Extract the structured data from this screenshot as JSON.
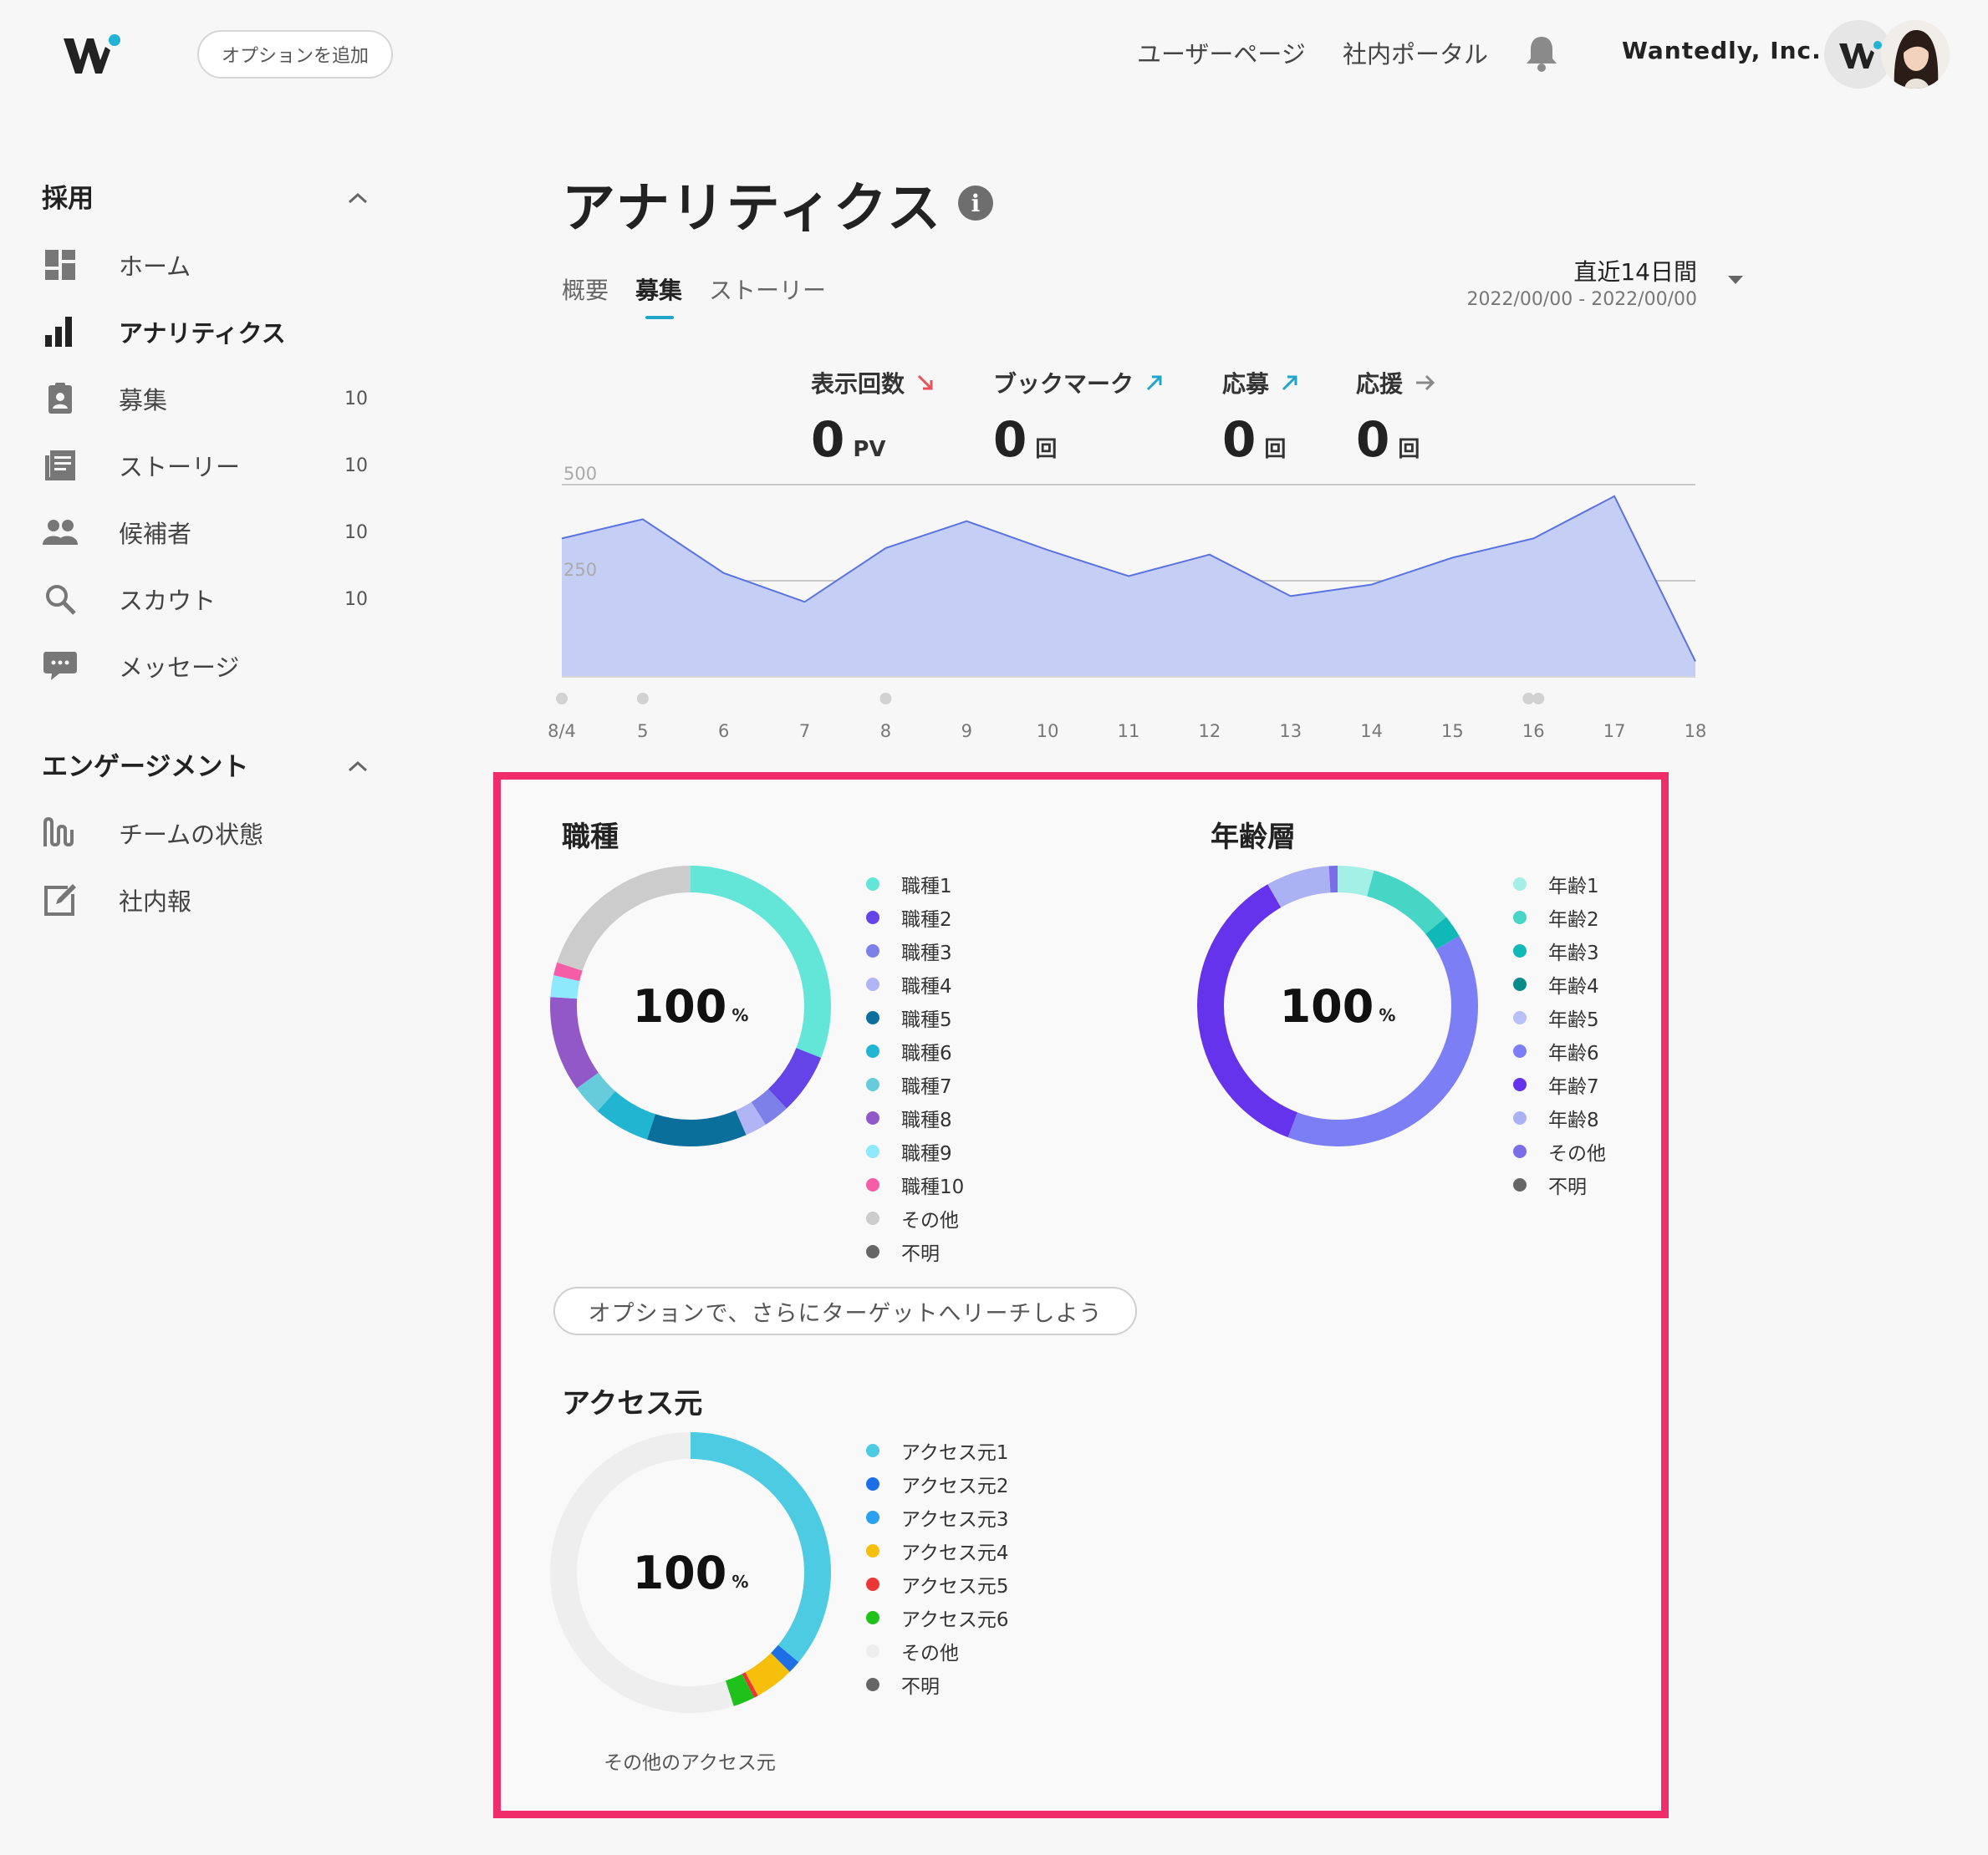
{
  "header": {
    "add_option_label": "オプションを追加",
    "nav": [
      "ユーザーページ",
      "社内ポータル"
    ],
    "company": "Wantedly, Inc."
  },
  "sidebar": {
    "sections": [
      {
        "title": "採用",
        "items": [
          {
            "label": "ホーム",
            "icon": "dashboard-icon",
            "count": ""
          },
          {
            "label": "アナリティクス",
            "icon": "bar-chart-icon",
            "count": "",
            "active": true
          },
          {
            "label": "募集",
            "icon": "recruit-icon",
            "count": "10"
          },
          {
            "label": "ストーリー",
            "icon": "story-icon",
            "count": "10"
          },
          {
            "label": "候補者",
            "icon": "people-icon",
            "count": "10"
          },
          {
            "label": "スカウト",
            "icon": "search-icon",
            "count": "10"
          },
          {
            "label": "メッセージ",
            "icon": "message-icon",
            "count": ""
          }
        ]
      },
      {
        "title": "エンゲージメント",
        "items": [
          {
            "label": "チームの状態",
            "icon": "team-status-icon",
            "count": ""
          },
          {
            "label": "社内報",
            "icon": "newsletter-icon",
            "count": ""
          }
        ]
      }
    ]
  },
  "main": {
    "title": "アナリティクス",
    "tabs": [
      "概要",
      "募集",
      "ストーリー"
    ],
    "active_tab": "募集",
    "period": {
      "label": "直近14日間",
      "range": "2022/00/00 - 2022/00/00"
    },
    "stats": [
      {
        "label": "表示回数",
        "value": "0",
        "unit": "PV",
        "trend": "down",
        "trend_color": "#e8505b"
      },
      {
        "label": "ブックマーク",
        "value": "0",
        "unit": "回",
        "trend": "up",
        "trend_color": "#21a6c8"
      },
      {
        "label": "応募",
        "value": "0",
        "unit": "回",
        "trend": "up",
        "trend_color": "#21a6c8"
      },
      {
        "label": "応援",
        "value": "0",
        "unit": "回",
        "trend": "flat",
        "trend_color": "#888888"
      }
    ],
    "cta_label": "オプションで、さらにターゲットへリーチしよう"
  },
  "chart_data": [
    {
      "type": "area",
      "x": [
        "8/4",
        "5",
        "6",
        "7",
        "8",
        "9",
        "10",
        "11",
        "12",
        "13",
        "14",
        "15",
        "16",
        "17",
        "18"
      ],
      "values": [
        360,
        410,
        270,
        195,
        335,
        405,
        330,
        262,
        318,
        210,
        240,
        310,
        360,
        470,
        40
      ],
      "yticks": [
        250,
        500
      ],
      "ylim": [
        0,
        500
      ],
      "grid": true,
      "event_markers": [
        "8/4",
        "5",
        "8",
        "16",
        "16"
      ],
      "fill_color": "#c5cef5",
      "line_color": "#5b73e0"
    },
    {
      "type": "pie",
      "title": "職種",
      "center_value": "100",
      "center_unit": "%",
      "labels": [
        "職種1",
        "職種2",
        "職種3",
        "職種4",
        "職種5",
        "職種6",
        "職種7",
        "職種8",
        "職種9",
        "職種10",
        "その他",
        "不明"
      ],
      "colors": [
        "#63e6d8",
        "#6444e6",
        "#7d80e8",
        "#b1b5f5",
        "#0b6f9c",
        "#22b5d2",
        "#66ccdc",
        "#9358c8",
        "#8de9fb",
        "#f55ea6",
        "#cccccc",
        "#666666"
      ],
      "values": [
        31,
        7,
        3,
        2.5,
        11.5,
        6.5,
        3.5,
        11,
        2.5,
        1.5,
        20,
        0
      ]
    },
    {
      "type": "pie",
      "title": "年齢層",
      "center_value": "100",
      "center_unit": "%",
      "labels": [
        "年齢1",
        "年齢2",
        "年齢3",
        "年齢4",
        "年齢5",
        "年齢6",
        "年齢7",
        "年齢8",
        "その他",
        "不明"
      ],
      "colors": [
        "#a5f0e6",
        "#47d6c6",
        "#11b8b8",
        "#0b8a8c",
        "#b7c1f8",
        "#7c7ef5",
        "#6533eb",
        "#abb2f4",
        "#7b6de8",
        "#666666"
      ],
      "values": [
        4,
        9.5,
        2.5,
        0,
        0,
        37.5,
        34.5,
        7,
        1,
        0
      ]
    },
    {
      "type": "pie",
      "title": "アクセス元",
      "center_value": "100",
      "center_unit": "%",
      "labels": [
        "アクセス元1",
        "アクセス元2",
        "アクセス元3",
        "アクセス元4",
        "アクセス元5",
        "アクセス元6",
        "その他",
        "不明"
      ],
      "colors": [
        "#4dcbe2",
        "#1e6ee6",
        "#2aa0ee",
        "#f6bf0c",
        "#ec3535",
        "#1fc21a",
        "#eeeeee",
        "#666666"
      ],
      "values": [
        36,
        1.5,
        0,
        4.5,
        0.5,
        2.5,
        55,
        0
      ],
      "caption": "その他のアクセス元"
    }
  ]
}
